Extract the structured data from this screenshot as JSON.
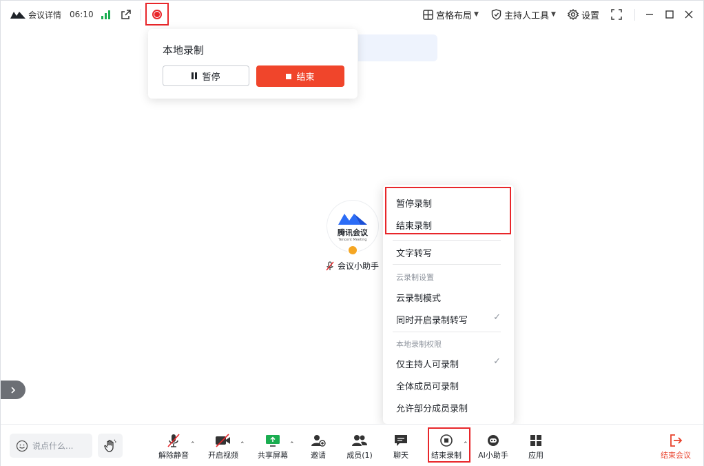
{
  "topbar": {
    "meeting_detail": "会议详情",
    "timer": "06:10",
    "grid_layout": "宫格布局",
    "host_tools": "主持人工具",
    "settings": "设置"
  },
  "record_popover": {
    "title": "本地录制",
    "pause": "暂停",
    "end": "结束"
  },
  "participant": {
    "brand_cn": "腾讯会议",
    "brand_en": "Tencent Meeting",
    "name": "会议小助手"
  },
  "record_menu": {
    "pause_recording": "暂停录制",
    "end_recording": "结束录制",
    "transcription": "文字转写",
    "cloud_header": "云录制设置",
    "cloud_mode": "云录制模式",
    "cloud_transcribe": "同时开启录制转写",
    "local_header": "本地录制权限",
    "host_only": "仅主持人可录制",
    "all_members": "全体成员可录制",
    "some_members": "允许部分成员录制"
  },
  "toolbar": {
    "say_placeholder": "说点什么...",
    "unmute": "解除静音",
    "start_video": "开启视频",
    "share_screen": "共享屏幕",
    "invite": "邀请",
    "members": "成员(1)",
    "chat": "聊天",
    "end_recording": "结束录制",
    "ai_assistant": "AI小助手",
    "apps": "应用",
    "end_meeting": "结束会议"
  },
  "colors": {
    "accent_red": "#e8262a",
    "end_button": "#f0452b",
    "signal_green": "#1aad50",
    "brand_blue": "#2b6cf6"
  }
}
